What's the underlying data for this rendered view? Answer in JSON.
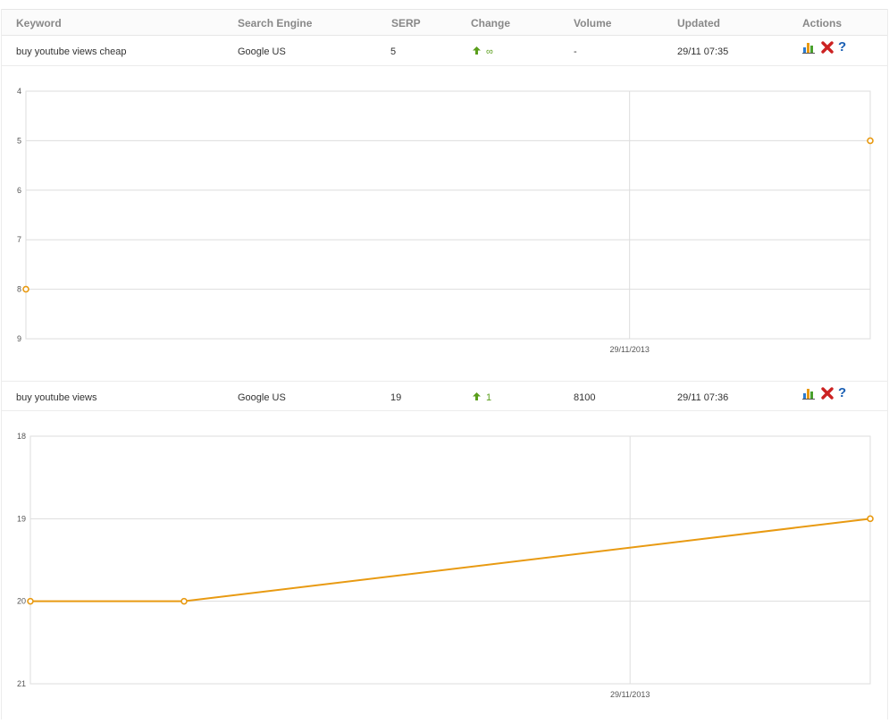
{
  "table": {
    "headers": {
      "keyword": "Keyword",
      "search_engine": "Search Engine",
      "serp": "SERP",
      "change": "Change",
      "volume": "Volume",
      "updated": "Updated",
      "actions": "Actions"
    },
    "rows": [
      {
        "keyword": "buy youtube views cheap",
        "search_engine": "Google US",
        "serp": "5",
        "change": "∞",
        "change_direction": "up",
        "volume": "-",
        "updated": "29/11 07:35",
        "icons": [
          "bar-chart-icon",
          "delete-icon",
          "help-icon"
        ]
      },
      {
        "keyword": "buy youtube views",
        "search_engine": "Google US",
        "serp": "19",
        "change": "1",
        "change_direction": "up",
        "volume": "8100",
        "updated": "29/11 07:36",
        "icons": [
          "bar-chart-icon",
          "delete-icon",
          "help-icon"
        ]
      }
    ]
  },
  "colors": {
    "line": "#e89a12",
    "up_arrow": "#5a9e1b",
    "delete": "#cc2222",
    "help": "#1a5fb4",
    "grid": "#dddddd"
  },
  "chart_data": [
    {
      "type": "line",
      "x": [
        0,
        1
      ],
      "y": [
        8,
        5
      ],
      "y_tick_labels": [
        "4",
        "5",
        "6",
        "7",
        "8",
        "9"
      ],
      "ylim": [
        4,
        9
      ],
      "y_inverted": true,
      "x_tick_label": "29/11/2013",
      "x_tick_position": 0.715,
      "show_line": false,
      "grid": true
    },
    {
      "type": "line",
      "x": [
        0,
        0.183,
        1
      ],
      "y": [
        20,
        20,
        19
      ],
      "y_tick_labels": [
        "18",
        "19",
        "20",
        "21"
      ],
      "ylim": [
        18,
        21
      ],
      "y_inverted": true,
      "x_tick_label": "29/11/2013",
      "x_tick_position": 0.714,
      "show_line": true,
      "grid": true
    }
  ]
}
